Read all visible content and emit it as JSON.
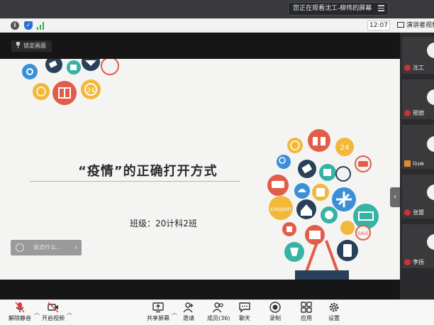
{
  "banner": {
    "sharing_text": "您正在观看沈工-柳伟的屏幕"
  },
  "toolbar": {
    "time": "12:07",
    "speaker_view_label": "演讲者视频"
  },
  "meeting": {
    "lock_label": "锁定画面"
  },
  "slide": {
    "title": "“疫情”的正确打开方式",
    "class_label": "班级：20计科2班",
    "comment_placeholder": "说点什么...",
    "deco_texts": {
      "coupon": "coupon",
      "sale": "SALE",
      "hours": "24"
    }
  },
  "participants": [
    {
      "name": "沈工"
    },
    {
      "name": "邢燃"
    },
    {
      "name": "liuw"
    },
    {
      "name": "张盟"
    },
    {
      "name": "李扬"
    }
  ],
  "controls": {
    "unmute": "解除静音",
    "start_video": "开启视频",
    "share_screen": "共享屏幕",
    "invite": "邀请",
    "members": "成员(36)",
    "chat": "聊天",
    "record": "录制",
    "apps": "应用",
    "settings": "设置"
  },
  "colors": {
    "orange": "#ef7e3f",
    "red": "#e25c4a",
    "teal": "#35b3a5",
    "navy": "#28405a",
    "blue": "#3a8fd6",
    "yellow": "#f2b83a"
  }
}
